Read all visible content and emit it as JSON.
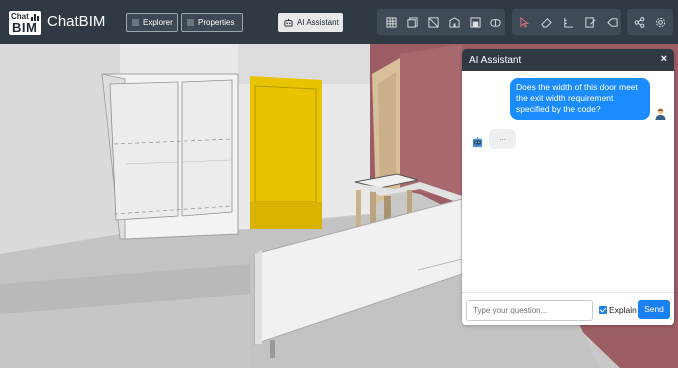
{
  "app": {
    "logo_top": "Chat",
    "logo_bottom": "BIM",
    "title": "ChatBIM"
  },
  "toolbar": {
    "explorer_label": "Explorer",
    "properties_label": "Properties",
    "ai_assistant_label": "AI Assistant",
    "view_tools": [
      "grid-icon",
      "pages-icon",
      "section-icon",
      "floorplan-icon",
      "elevation-icon",
      "box-icon"
    ],
    "edit_tools": [
      "pointer-icon",
      "eraser-icon",
      "measure-icon",
      "annotate-icon",
      "tag-icon"
    ],
    "settings_tools": [
      "share-icon",
      "gear-icon"
    ]
  },
  "ai_panel": {
    "title": "AI Assistant",
    "close_label": "×",
    "user_message": "Does the width of this door meet the exit width requirement specified by the code?",
    "typing_indicator": "...",
    "input_placeholder": "Type your question...",
    "explain_label": "Explain",
    "explain_checked": true,
    "send_label": "Send"
  },
  "colors": {
    "topbar": "#2f3a44",
    "accent_blue": "#1a8cff",
    "door_yellow": "#e8c400",
    "wall_red": "#9c5e64"
  }
}
